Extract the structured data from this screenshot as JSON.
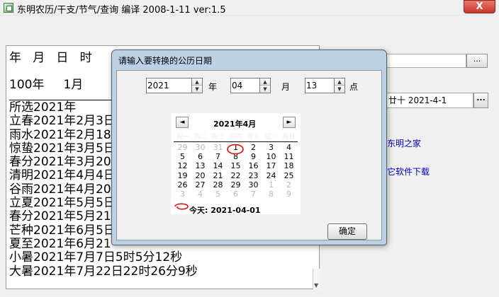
{
  "app": {
    "title": "东明农历/干支/节气/查询    编译 2008-1-11   ver:1.5",
    "close_label": "X"
  },
  "left_panel": {
    "header": "年   月   日   时",
    "year_row": "100年     1月",
    "lines": [
      "所选2021年",
      "立春2021年2月3日",
      "雨水2021年2月18",
      "惊蛰2021年3月5日",
      "春分2021年3月20",
      "清明2021年4月4日",
      "谷雨2021年4月20",
      "立夏2021年5月5日",
      "春分2021年5月21",
      "芒种2021年6月5日",
      "夏至2021年6月21",
      "小暑2021年7月7日5时5分12秒",
      "大暑2021年7月22日22时26分9秒"
    ],
    "scroll_arrow": "▼"
  },
  "right_panel": {
    "browse_label": "...",
    "date_field": "廿十  2021-4-1",
    "date_button": "...",
    "link_home": "东明之家",
    "link_download": "它软件下载"
  },
  "dialog": {
    "title": "请输入要转换的公历日期",
    "year_value": "2021",
    "year_label": "年",
    "month_value": "04",
    "month_label": "月",
    "hour_value": "13",
    "hour_label": "点",
    "spin_up": "▲",
    "spin_down": "▼",
    "confirm_label": "确定"
  },
  "calendar": {
    "header": "2021年4月",
    "prev": "◄",
    "next": "►",
    "weekdays": [
      "周一",
      "周二",
      "周三",
      "周四",
      "周五",
      "周六",
      "周日"
    ],
    "days": [
      {
        "d": "29",
        "m": true
      },
      {
        "d": "30",
        "m": true
      },
      {
        "d": "31",
        "m": true
      },
      {
        "d": "1",
        "m": false
      },
      {
        "d": "2",
        "m": false
      },
      {
        "d": "3",
        "m": false
      },
      {
        "d": "4",
        "m": false
      },
      {
        "d": "5",
        "m": false
      },
      {
        "d": "6",
        "m": false
      },
      {
        "d": "7",
        "m": false
      },
      {
        "d": "8",
        "m": false
      },
      {
        "d": "9",
        "m": false
      },
      {
        "d": "10",
        "m": false
      },
      {
        "d": "11",
        "m": false
      },
      {
        "d": "12",
        "m": false
      },
      {
        "d": "13",
        "m": false
      },
      {
        "d": "14",
        "m": false
      },
      {
        "d": "15",
        "m": false
      },
      {
        "d": "16",
        "m": false
      },
      {
        "d": "17",
        "m": false
      },
      {
        "d": "18",
        "m": false
      },
      {
        "d": "19",
        "m": false
      },
      {
        "d": "20",
        "m": false
      },
      {
        "d": "21",
        "m": false
      },
      {
        "d": "22",
        "m": false
      },
      {
        "d": "23",
        "m": false
      },
      {
        "d": "24",
        "m": false
      },
      {
        "d": "25",
        "m": false
      },
      {
        "d": "26",
        "m": false
      },
      {
        "d": "27",
        "m": false
      },
      {
        "d": "28",
        "m": false
      },
      {
        "d": "29",
        "m": false
      },
      {
        "d": "30",
        "m": false
      },
      {
        "d": "1",
        "m": true
      },
      {
        "d": "2",
        "m": true
      },
      {
        "d": "3",
        "m": true
      },
      {
        "d": "4",
        "m": true
      },
      {
        "d": "5",
        "m": true
      },
      {
        "d": "6",
        "m": true
      },
      {
        "d": "7",
        "m": true
      },
      {
        "d": "8",
        "m": true
      },
      {
        "d": "9",
        "m": true
      }
    ],
    "selected_day": "1",
    "today_label": "今天:  2021-04-01",
    "highlight_color": "#e00000"
  }
}
